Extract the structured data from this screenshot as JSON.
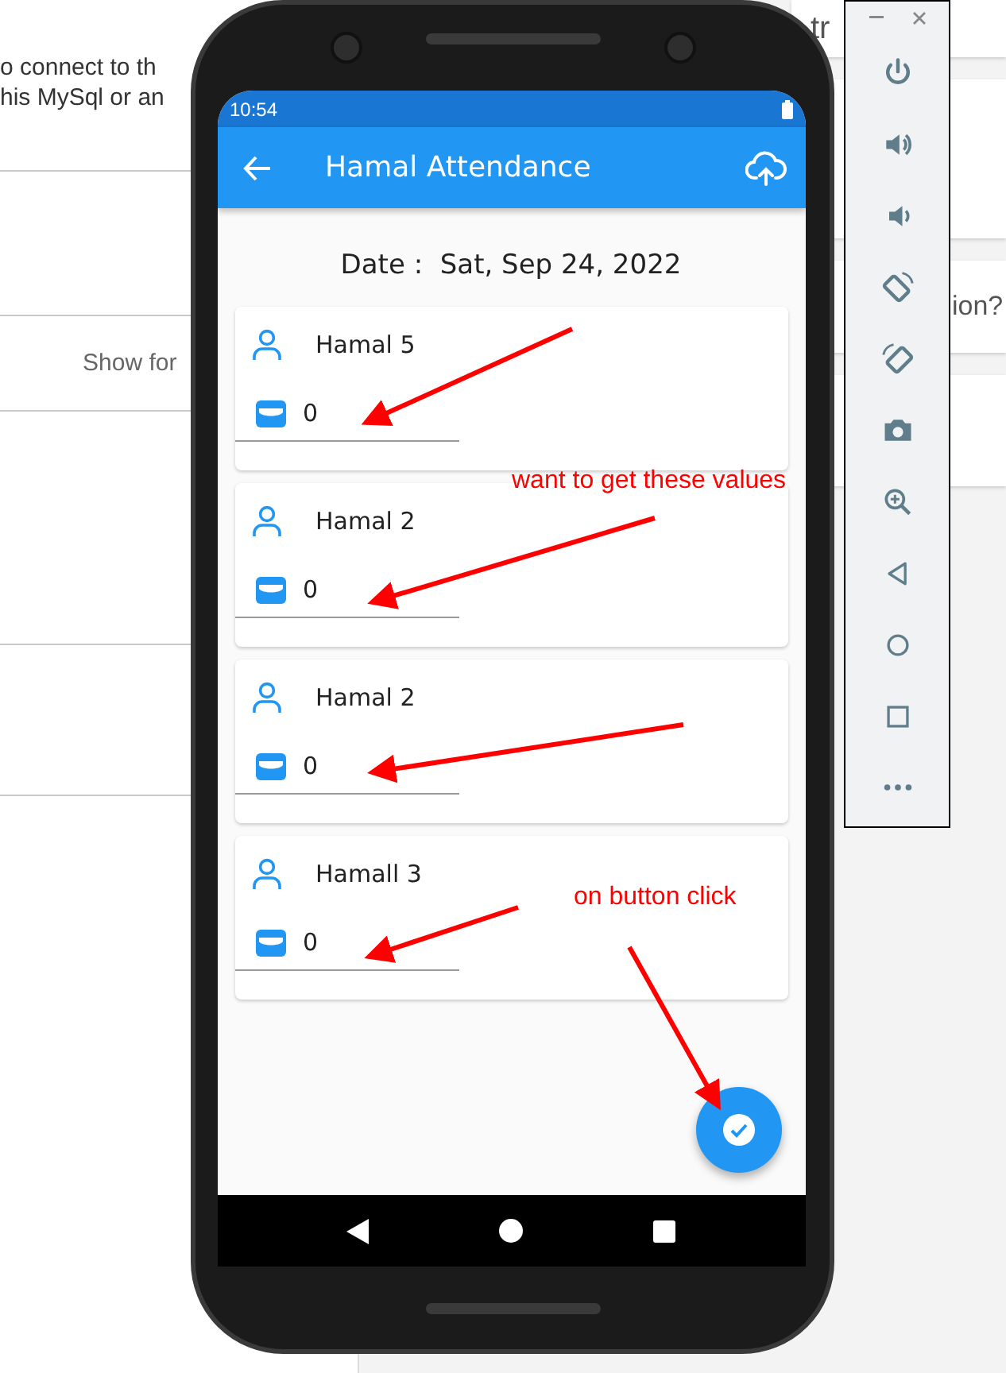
{
  "background_page": {
    "left_lines": [
      "o connect to th",
      "his MySql or an"
    ],
    "show_link": "Show for",
    "right_texts": [
      "tr",
      "ion?"
    ]
  },
  "phone": {
    "status_bar": {
      "time": "10:54"
    },
    "app_bar": {
      "title": "Hamal Attendance"
    },
    "date_text": "Date :  Sat, Sep 24, 2022",
    "cards": [
      {
        "name": "Hamal 5",
        "value": "0"
      },
      {
        "name": "Hamal 2",
        "value": "0"
      },
      {
        "name": "Hamal 2",
        "value": "0"
      },
      {
        "name": "Hamall 3",
        "value": "0"
      }
    ]
  },
  "emulator_toolbar": {
    "buttons": [
      {
        "kind": "power"
      },
      {
        "kind": "volume_up"
      },
      {
        "kind": "volume_down"
      },
      {
        "kind": "rotate_left"
      },
      {
        "kind": "rotate_right"
      },
      {
        "kind": "camera"
      },
      {
        "kind": "zoom"
      },
      {
        "kind": "back"
      },
      {
        "kind": "home"
      },
      {
        "kind": "overview"
      },
      {
        "kind": "more"
      }
    ]
  },
  "annotations": [
    {
      "text": "want to get these values"
    },
    {
      "text": "on button click"
    }
  ]
}
